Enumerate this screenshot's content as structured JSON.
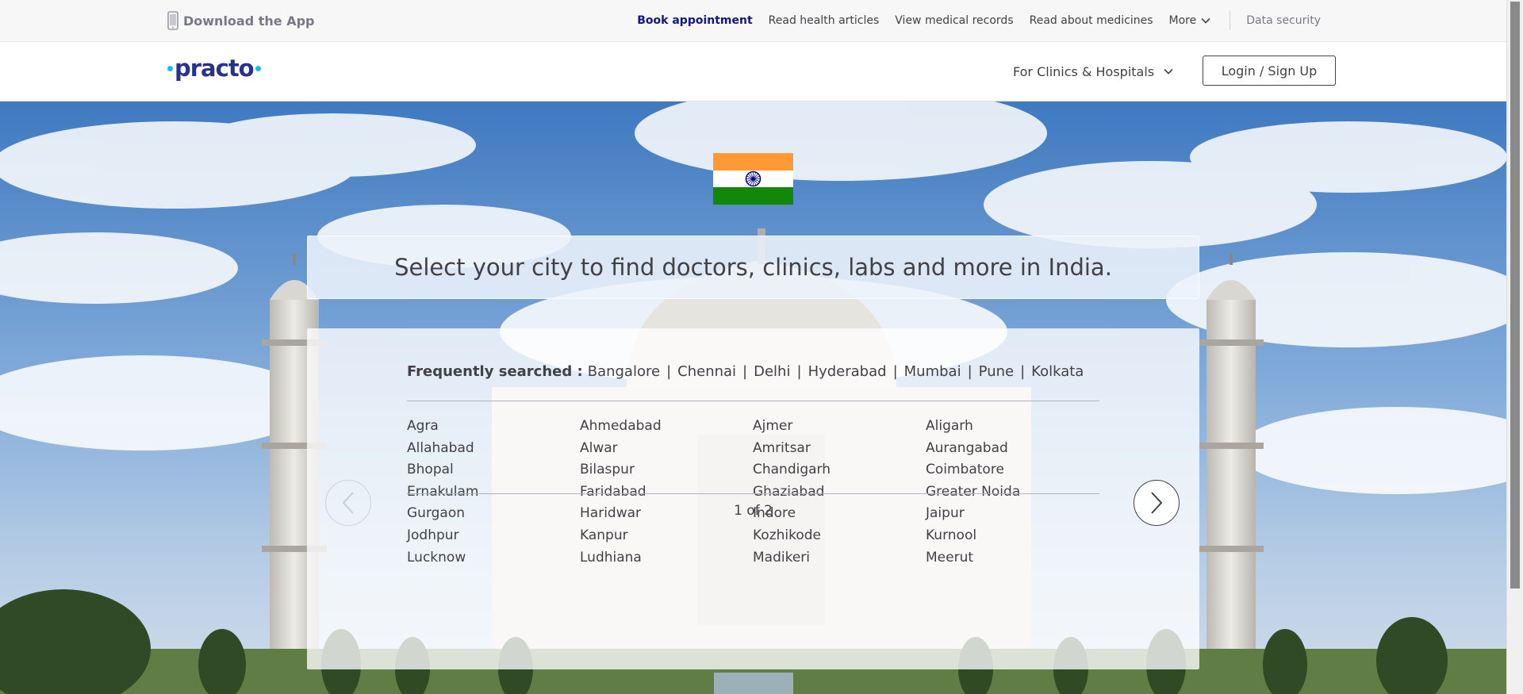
{
  "topbar": {
    "download_app": "Download the App",
    "links": {
      "book": "Book appointment",
      "articles": "Read health articles",
      "records": "View medical records",
      "medicines": "Read about medicines",
      "more": "More",
      "security": "Data security"
    }
  },
  "header": {
    "logo_text": "practo",
    "clinics_dropdown": "For Clinics & Hospitals",
    "login_button": "Login / Sign Up"
  },
  "hero": {
    "headline": "Select your city to find doctors, clinics, labs and more in India.",
    "frequently_searched_label": "Frequently searched :",
    "frequent_cities": [
      "Bangalore",
      "Chennai",
      "Delhi",
      "Hyderabad",
      "Mumbai",
      "Pune",
      "Kolkata"
    ],
    "cities": [
      "Agra",
      "Ahmedabad",
      "Ajmer",
      "Aligarh",
      "Allahabad",
      "Alwar",
      "Amritsar",
      "Aurangabad",
      "Bhopal",
      "Bilaspur",
      "Chandigarh",
      "Coimbatore",
      "Ernakulam",
      "Faridabad",
      "Ghaziabad",
      "Greater Noida",
      "Gurgaon",
      "Haridwar",
      "Indore",
      "Jaipur",
      "Jodhpur",
      "Kanpur",
      "Kozhikode",
      "Kurnool",
      "Lucknow",
      "Ludhiana",
      "Madikeri",
      "Meerut"
    ],
    "pager": "1 of 2"
  },
  "icons": {
    "phone": "phone-icon",
    "chevron": "chevron-down-icon",
    "prev": "chevron-left-icon",
    "next": "chevron-right-icon",
    "flag": "india-flag"
  },
  "colors": {
    "brand_navy": "#28328c",
    "brand_cyan": "#14bef0",
    "active_link": "#14148c",
    "text": "#414146",
    "flag_saffron": "#ff9933",
    "flag_green": "#138808",
    "chakra_blue": "#000080"
  }
}
